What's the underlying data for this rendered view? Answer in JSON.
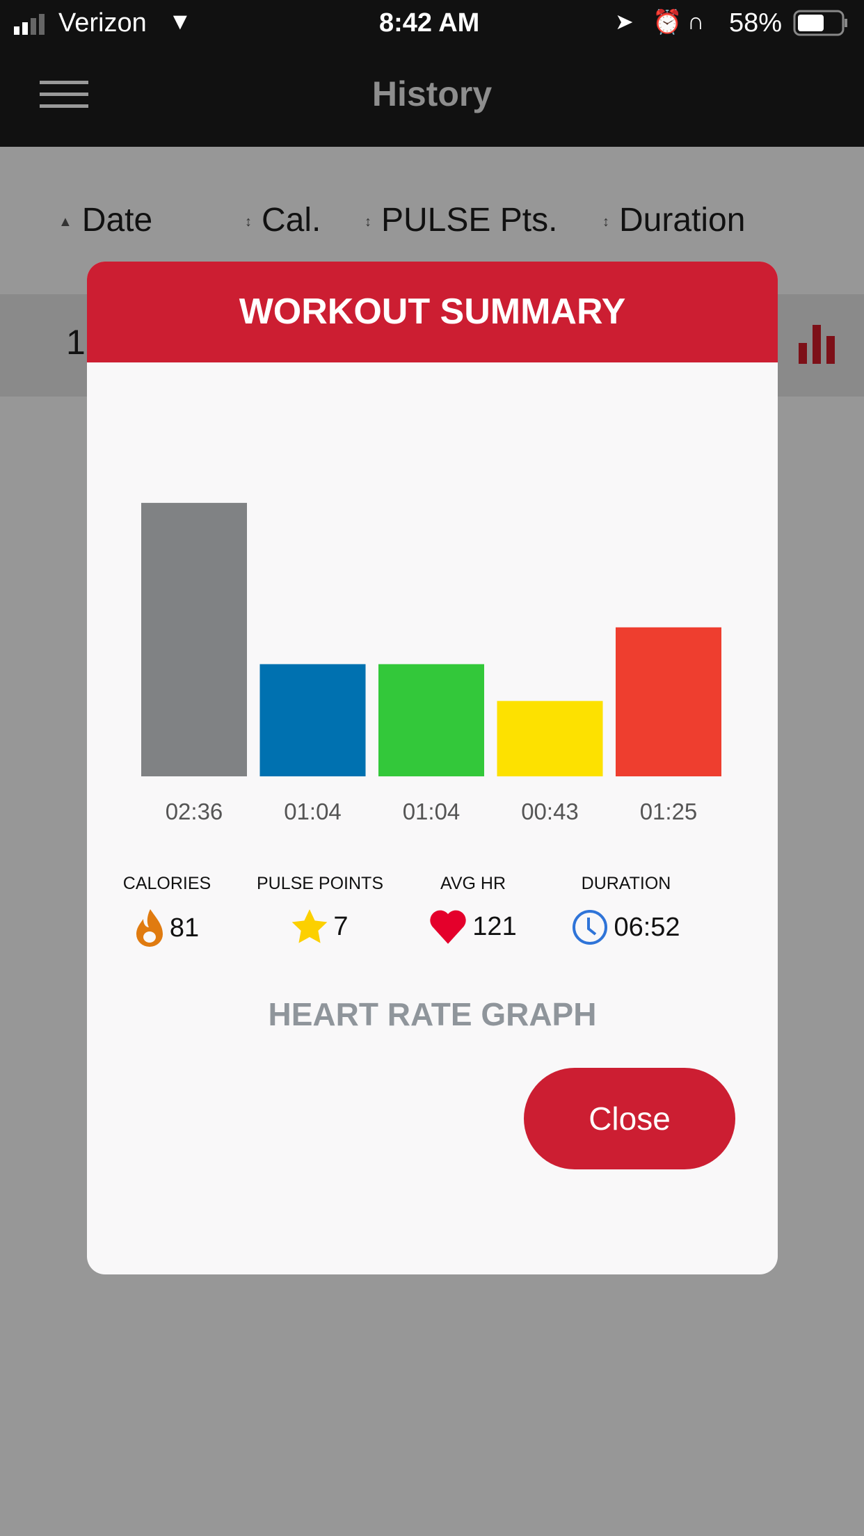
{
  "status_bar": {
    "carrier": "Verizon",
    "time": "8:42 AM",
    "battery": "58%",
    "battery_level": 0.58
  },
  "nav": {
    "title": "History",
    "menu_icon": "hamburger-icon"
  },
  "table_header": {
    "columns": [
      "Date",
      "Cal.",
      "PULSE Pts.",
      "Duration"
    ],
    "sort": "Date ascending"
  },
  "row": {
    "first_digit": "1",
    "icon": "bar-chart-icon"
  },
  "modal": {
    "title": "WORKOUT SUMMARY",
    "stats": [
      {
        "label": "CALORIES",
        "value": "81",
        "icon": "flame-icon",
        "color": "#e07b10"
      },
      {
        "label": "PULSE POINTS",
        "value": "7",
        "icon": "star-icon",
        "color": "#fcd000"
      },
      {
        "label": "AVG HR",
        "value": "121",
        "icon": "heart-icon",
        "color": "#e4002b"
      },
      {
        "label": "DURATION",
        "value": "06:52",
        "icon": "clock-icon",
        "color": "#2f74d8"
      }
    ],
    "heart_rate_graph_label": "HEART RATE GRAPH",
    "close_label": "Close",
    "accent": "#cc1e32"
  },
  "chart_data": {
    "type": "bar",
    "categories": [
      "02:36",
      "01:04",
      "01:04",
      "00:43",
      "01:25"
    ],
    "values": [
      156,
      64,
      64,
      43,
      85
    ],
    "value_unit": "seconds",
    "colors": [
      "#808284",
      "#0071b0",
      "#33c83a",
      "#fde100",
      "#ee3e2f"
    ],
    "title": "",
    "xlabel": "",
    "ylabel": "",
    "grid": false
  }
}
